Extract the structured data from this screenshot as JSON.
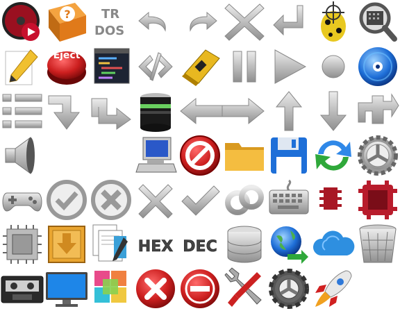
{
  "sheet": {
    "background": "#ffffff",
    "labels": {
      "eject": "Eject",
      "tr": "TR",
      "dos": "DOS",
      "hex": "HEX",
      "dec": "DEC"
    },
    "colors": {
      "metal": "#c9c9c9",
      "metal_dark": "#8c8c8c",
      "red": "#cc1f1f",
      "dark_red": "#8a0d18",
      "blue": "#1e6fd8",
      "green": "#2fa83a",
      "folder": "#f0b430",
      "gold": "#e8b820"
    }
  }
}
